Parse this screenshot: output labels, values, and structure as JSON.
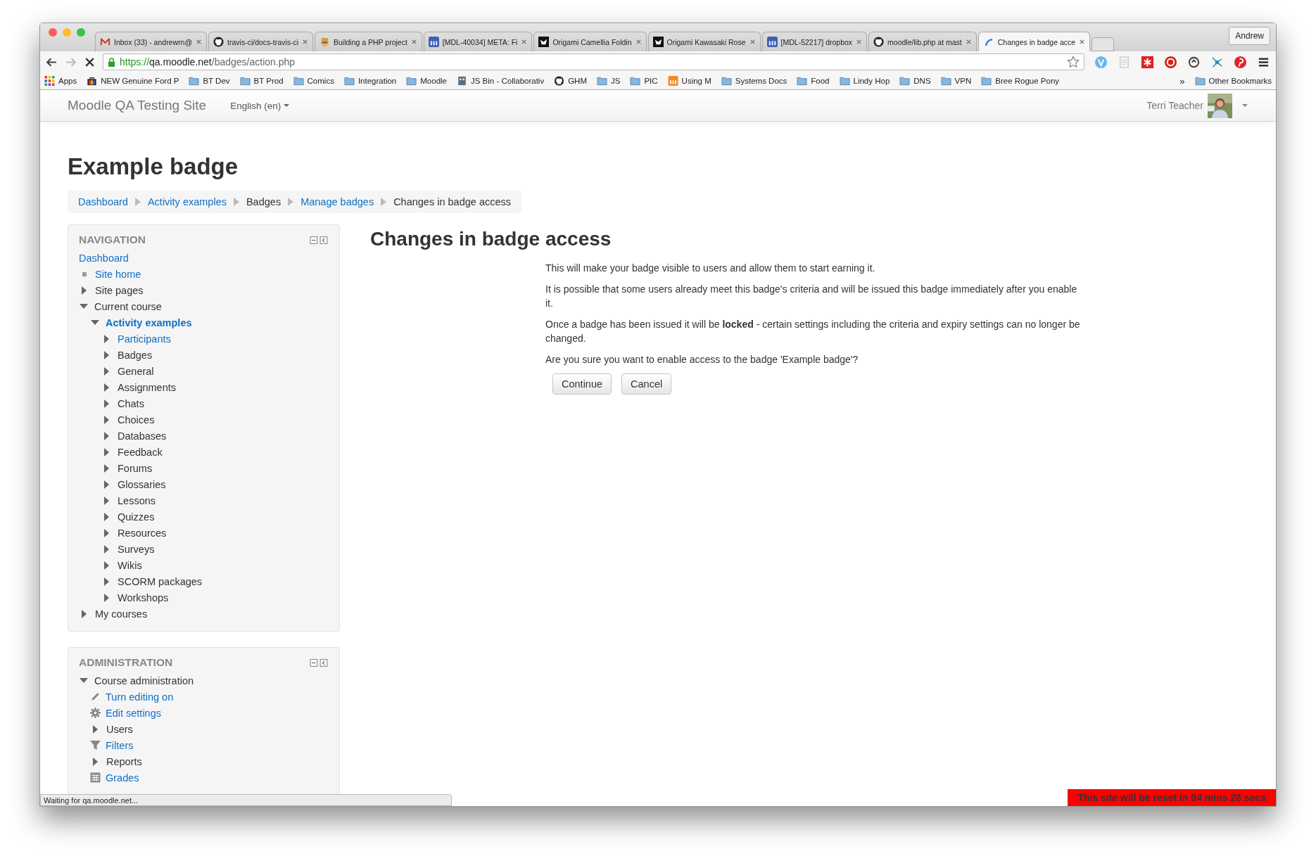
{
  "browser": {
    "tabs": [
      {
        "kind": "mail",
        "title": "Inbox (33) - andrewrn@",
        "selected": false
      },
      {
        "kind": "github",
        "title": "travis-ci/docs-travis-ci",
        "selected": false
      },
      {
        "kind": "mascot",
        "title": "Building a PHP project",
        "selected": false
      },
      {
        "kind": "moodle",
        "title": "[MDL-40034] META: Fi",
        "selected": false
      },
      {
        "kind": "origami",
        "title": "Origami Camellia Foldin",
        "selected": false
      },
      {
        "kind": "origami",
        "title": "Origami Kawasaki Rose",
        "selected": false
      },
      {
        "kind": "moodle",
        "title": "[MDL-52217] dropbox",
        "selected": false
      },
      {
        "kind": "github",
        "title": "moodle/lib.php at mast",
        "selected": false
      },
      {
        "kind": "loading",
        "title": "Changes in badge acce",
        "selected": true
      }
    ],
    "profile": "Andrew",
    "url": {
      "scheme": "https://",
      "host": "qa.moodle.net",
      "path": "/badges/action.php"
    },
    "bookmarks": [
      {
        "kind": "apps",
        "label": "Apps"
      },
      {
        "kind": "bag",
        "label": "NEW Genuine Ford P"
      },
      {
        "kind": "folder",
        "label": "BT Dev"
      },
      {
        "kind": "folder",
        "label": "BT Prod"
      },
      {
        "kind": "folder",
        "label": "Comics"
      },
      {
        "kind": "folder",
        "label": "Integration"
      },
      {
        "kind": "folder",
        "label": "Moodle"
      },
      {
        "kind": "jsbin",
        "label": "JS Bin - Collaborativ"
      },
      {
        "kind": "github",
        "label": "GHM"
      },
      {
        "kind": "folder",
        "label": "JS"
      },
      {
        "kind": "folder",
        "label": "PIC"
      },
      {
        "kind": "moodle",
        "label": "Using M"
      },
      {
        "kind": "folder",
        "label": "Systems Docs"
      },
      {
        "kind": "folder",
        "label": "Food"
      },
      {
        "kind": "folder",
        "label": "Lindy Hop"
      },
      {
        "kind": "folder",
        "label": "DNS"
      },
      {
        "kind": "folder",
        "label": "VPN"
      },
      {
        "kind": "folder",
        "label": "Bree Rogue Pony"
      }
    ],
    "bookmarks_more": "»",
    "other_bookmarks": "Other Bookmarks",
    "status": "Waiting for qa.moodle.net..."
  },
  "site": {
    "name": "Moodle QA Testing Site",
    "language": "English (en)",
    "user": "Terri Teacher"
  },
  "page_title": "Example badge",
  "breadcrumb": [
    {
      "label": "Dashboard",
      "link": true
    },
    {
      "label": "Activity examples",
      "link": true
    },
    {
      "label": "Badges",
      "link": false
    },
    {
      "label": "Manage badges",
      "link": true
    },
    {
      "label": "Changes in badge access",
      "link": false
    }
  ],
  "navigation": {
    "title": "NAVIGATION",
    "items": [
      {
        "kind": "plain",
        "label": "Dashboard",
        "link": true,
        "active": false
      },
      {
        "kind": "bullet",
        "label": "Site home",
        "link": true,
        "active": false
      },
      {
        "kind": "branch",
        "label": "Site pages",
        "link": false,
        "expanded": false,
        "active": false
      },
      {
        "kind": "branch",
        "label": "Current course",
        "link": false,
        "expanded": true,
        "active": false,
        "children": [
          {
            "kind": "branch",
            "label": "Activity examples",
            "link": true,
            "expanded": true,
            "active": true,
            "children": [
              {
                "kind": "branch",
                "label": "Participants",
                "link": true,
                "expanded": false,
                "active": false
              },
              {
                "kind": "branch",
                "label": "Badges",
                "link": false,
                "expanded": false,
                "active": false
              },
              {
                "kind": "branch",
                "label": "General",
                "link": false,
                "expanded": false,
                "active": false
              },
              {
                "kind": "branch",
                "label": "Assignments",
                "link": false,
                "expanded": false,
                "active": false
              },
              {
                "kind": "branch",
                "label": "Chats",
                "link": false,
                "expanded": false,
                "active": false
              },
              {
                "kind": "branch",
                "label": "Choices",
                "link": false,
                "expanded": false,
                "active": false
              },
              {
                "kind": "branch",
                "label": "Databases",
                "link": false,
                "expanded": false,
                "active": false
              },
              {
                "kind": "branch",
                "label": "Feedback",
                "link": false,
                "expanded": false,
                "active": false
              },
              {
                "kind": "branch",
                "label": "Forums",
                "link": false,
                "expanded": false,
                "active": false
              },
              {
                "kind": "branch",
                "label": "Glossaries",
                "link": false,
                "expanded": false,
                "active": false
              },
              {
                "kind": "branch",
                "label": "Lessons",
                "link": false,
                "expanded": false,
                "active": false
              },
              {
                "kind": "branch",
                "label": "Quizzes",
                "link": false,
                "expanded": false,
                "active": false
              },
              {
                "kind": "branch",
                "label": "Resources",
                "link": false,
                "expanded": false,
                "active": false
              },
              {
                "kind": "branch",
                "label": "Surveys",
                "link": false,
                "expanded": false,
                "active": false
              },
              {
                "kind": "branch",
                "label": "Wikis",
                "link": false,
                "expanded": false,
                "active": false
              },
              {
                "kind": "branch",
                "label": "SCORM packages",
                "link": false,
                "expanded": false,
                "active": false
              },
              {
                "kind": "branch",
                "label": "Workshops",
                "link": false,
                "expanded": false,
                "active": false
              }
            ]
          }
        ]
      },
      {
        "kind": "branch",
        "label": "My courses",
        "link": false,
        "expanded": false,
        "active": false
      }
    ]
  },
  "administration": {
    "title": "ADMINISTRATION",
    "items": [
      {
        "kind": "branch",
        "label": "Course administration",
        "link": false,
        "expanded": true,
        "active": false,
        "children": [
          {
            "kind": "pencil",
            "label": "Turn editing on",
            "link": true,
            "active": false
          },
          {
            "kind": "gear",
            "label": "Edit settings",
            "link": true,
            "active": false
          },
          {
            "kind": "branch",
            "label": "Users",
            "link": false,
            "expanded": false,
            "active": false
          },
          {
            "kind": "filter",
            "label": "Filters",
            "link": true,
            "active": false
          },
          {
            "kind": "branch",
            "label": "Reports",
            "link": false,
            "expanded": false,
            "active": false
          },
          {
            "kind": "table",
            "label": "Grades",
            "link": true,
            "active": false
          }
        ]
      }
    ]
  },
  "main": {
    "heading": "Changes in badge access",
    "paragraphs": [
      "This will make your badge visible to users and allow them to start earning it.",
      "It is possible that some users already meet this badge's criteria and will be issued this badge immediately after you enable it.",
      "Once a badge has been issued it will be **locked** - certain settings including the criteria and expiry settings can no longer be changed.",
      "Are you sure you want to enable access to the badge 'Example badge'?"
    ],
    "buttons": [
      "Continue",
      "Cancel"
    ]
  },
  "reset_notice": "This site will be reset in 04 mins 28 secs"
}
